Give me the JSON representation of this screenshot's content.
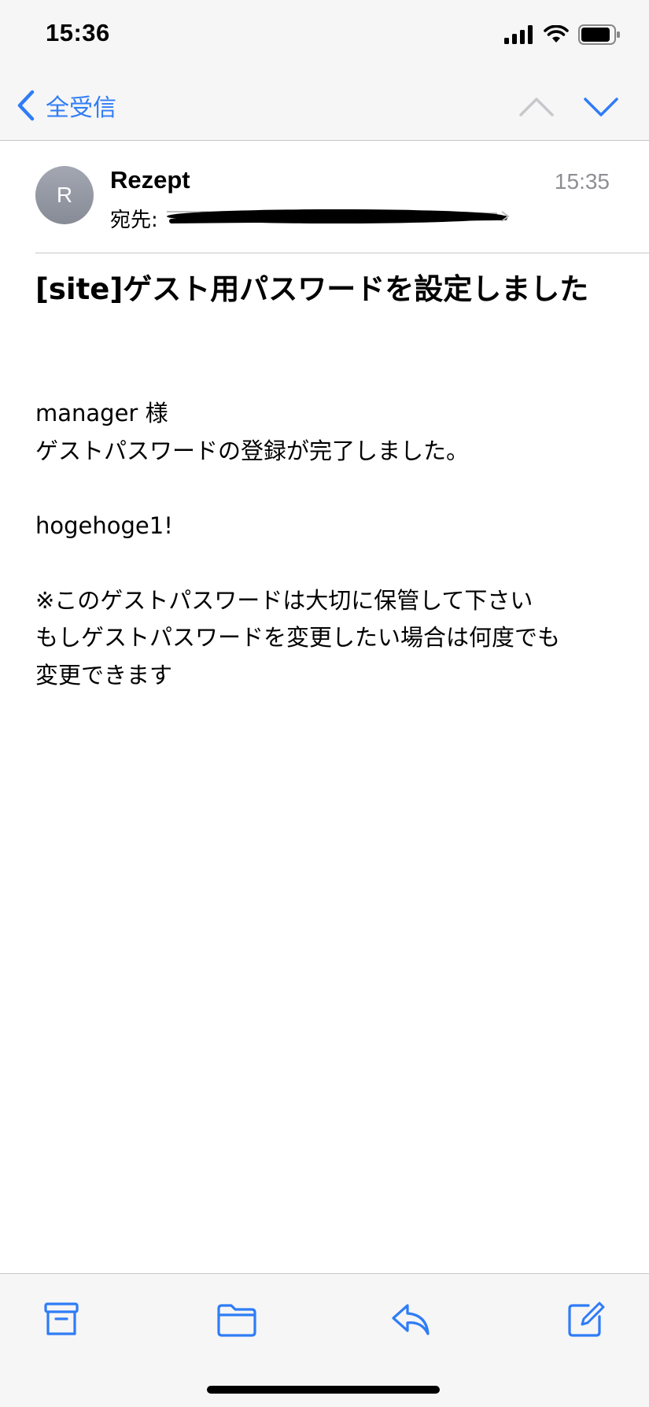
{
  "status_bar": {
    "time": "15:36"
  },
  "nav": {
    "back_label": "全受信",
    "up_icon": "chevron-up-icon",
    "down_icon": "chevron-down-icon"
  },
  "message": {
    "avatar_initial": "R",
    "sender": "Rezept",
    "recipient_label": "宛先:",
    "time": "15:35",
    "subject": "[site]ゲスト用パスワードを設定しました",
    "body_lines": [
      "manager 様",
      "ゲストパスワードの登録が完了しました。",
      "",
      "hogehoge1!",
      "",
      "※このゲストパスワードは大切に保管して下さい",
      "もしゲストパスワードを変更したい場合は何度でも",
      "変更できます"
    ]
  },
  "toolbar": {
    "icons": [
      "archive-icon",
      "folder-icon",
      "reply-icon",
      "compose-icon"
    ]
  },
  "colors": {
    "accent": "#2f7cf6",
    "disabled": "#c7c7cc",
    "bar_bg": "#f6f6f6",
    "secondary_text": "#8e8e93"
  }
}
